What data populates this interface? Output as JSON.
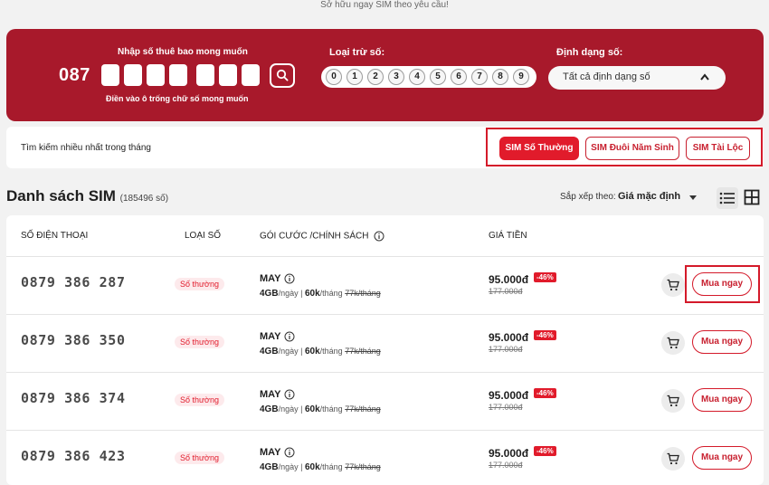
{
  "top_caption": "Sở hữu ngay SIM theo yêu cầu!",
  "search": {
    "number_label": "Nhập số thuê bao mong muốn",
    "prefix": "087",
    "hint": "Điền vào ô trống chữ số mong muốn",
    "exclude_label": "Loại trừ số:",
    "exclude_digits": [
      "0",
      "1",
      "2",
      "3",
      "4",
      "5",
      "6",
      "7",
      "8",
      "9"
    ],
    "format_label": "Định dạng số:",
    "format_value": "Tất cả định dạng số"
  },
  "filters": {
    "title": "Tìm kiếm nhiều nhất trong tháng",
    "chips": [
      "SIM Số Thường",
      "SIM Đuôi Năm Sinh",
      "SIM Tài Lộc"
    ]
  },
  "list": {
    "title": "Danh sách SIM",
    "count": "(185496 số)",
    "sort_label": "Sắp xếp theo:",
    "sort_value": "Giá mặc định"
  },
  "table": {
    "headers": [
      "SỐ ĐIỆN THOẠI",
      "LOẠI SỐ",
      "GÓI CƯỚC /CHÍNH SÁCH",
      "GIÁ TIỀN"
    ],
    "rows": [
      {
        "phone": "0879 386 287",
        "type": "Số thường",
        "plan": "MAY",
        "data": "4GB",
        "per_day": "/ngày",
        "sep": "|",
        "fee": "60k",
        "per_month": "/tháng",
        "old_fee": "77k/tháng",
        "price": "95.000đ",
        "discount": "-46%",
        "old_price": "177.000đ",
        "buy": "Mua ngay"
      },
      {
        "phone": "0879 386 350",
        "type": "Số thường",
        "plan": "MAY",
        "data": "4GB",
        "per_day": "/ngày",
        "sep": "|",
        "fee": "60k",
        "per_month": "/tháng",
        "old_fee": "77k/tháng",
        "price": "95.000đ",
        "discount": "-46%",
        "old_price": "177.000đ",
        "buy": "Mua ngay"
      },
      {
        "phone": "0879 386 374",
        "type": "Số thường",
        "plan": "MAY",
        "data": "4GB",
        "per_day": "/ngày",
        "sep": "|",
        "fee": "60k",
        "per_month": "/tháng",
        "old_fee": "77k/tháng",
        "price": "95.000đ",
        "discount": "-46%",
        "old_price": "177.000đ",
        "buy": "Mua ngay"
      },
      {
        "phone": "0879 386 423",
        "type": "Số thường",
        "plan": "MAY",
        "data": "4GB",
        "per_day": "/ngày",
        "sep": "|",
        "fee": "60k",
        "per_month": "/tháng",
        "old_fee": "77k/tháng",
        "price": "95.000đ",
        "discount": "-46%",
        "old_price": "177.000đ",
        "buy": "Mua ngay"
      }
    ]
  },
  "colors": {
    "brand": "#a8192b",
    "accent": "#e11b2b"
  },
  "icons": [
    "search-icon",
    "chevron-up-icon",
    "list-view-icon",
    "grid-view-icon",
    "info-icon",
    "cart-icon"
  ]
}
